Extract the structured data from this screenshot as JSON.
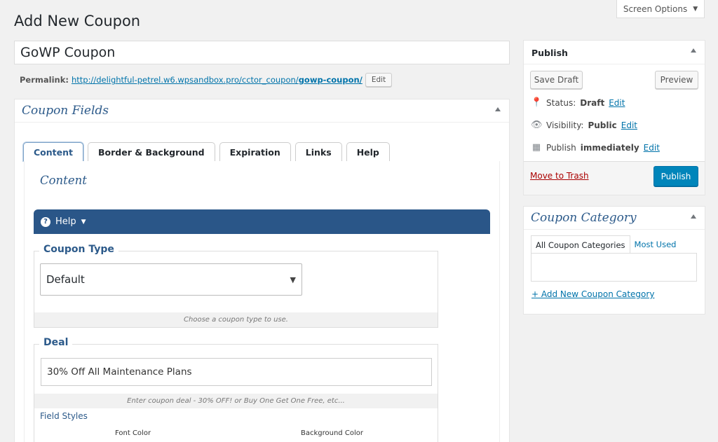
{
  "header": {
    "title": "Add New Coupon",
    "screen_options": "Screen Options"
  },
  "post": {
    "title": "GoWP Coupon",
    "permalink_label": "Permalink:",
    "permalink_base": "http://delightful-petrel.w6.wpsandbox.pro/cctor_coupon/",
    "permalink_slug": "gowp-coupon/",
    "edit_label": "Edit"
  },
  "coupon_fields": {
    "title": "Coupon Fields",
    "tabs": [
      "Content",
      "Border & Background",
      "Expiration",
      "Links",
      "Help"
    ],
    "active_tab": "Content",
    "section_heading": "Content",
    "help_label": "Help",
    "coupon_type": {
      "legend": "Coupon Type",
      "value": "Default",
      "help": "Choose a coupon type to use."
    },
    "deal": {
      "legend": "Deal",
      "value": "30% Off All Maintenance Plans",
      "help": "Enter coupon deal - 30% OFF! or Buy One Get One Free, etc...",
      "field_styles": "Field Styles",
      "font_color": "Font Color",
      "background_color": "Background Color"
    }
  },
  "publish": {
    "title": "Publish",
    "save_draft": "Save Draft",
    "preview": "Preview",
    "status_label": "Status:",
    "status_value": "Draft",
    "visibility_label": "Visibility:",
    "visibility_value": "Public",
    "publish_label": "Publish",
    "publish_value": "immediately",
    "edit": "Edit",
    "trash": "Move to Trash",
    "publish_button": "Publish"
  },
  "category": {
    "title": "Coupon Category",
    "tab_all": "All Coupon Categories",
    "tab_most_used": "Most Used",
    "add_new": "+ Add New Coupon Category"
  },
  "colors": {
    "accent": "#2c5a8a",
    "help_bar": "#2a5688",
    "link": "#0073aa",
    "primary_button": "#0085ba",
    "trash": "#aa0000"
  }
}
